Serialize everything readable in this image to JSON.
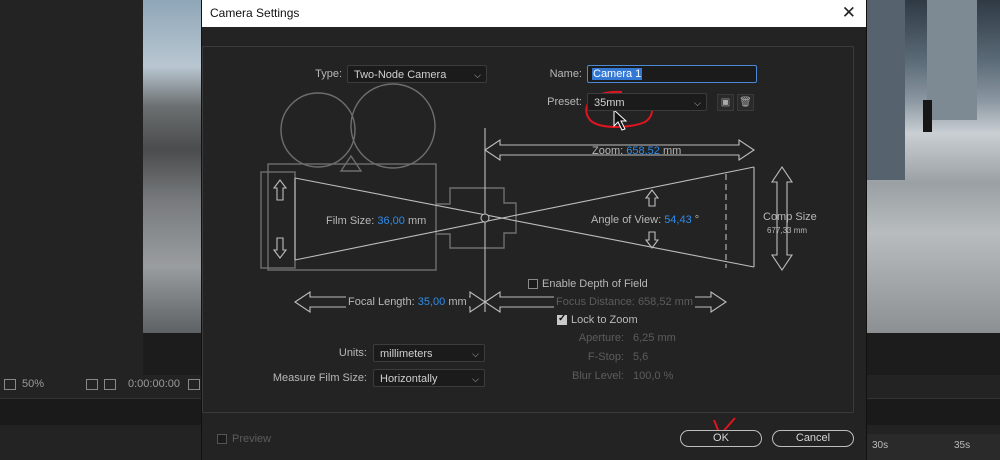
{
  "dialog": {
    "title": "Camera Settings",
    "close_glyph": "✕"
  },
  "type": {
    "label": "Type:",
    "value": "Two-Node Camera"
  },
  "name": {
    "label": "Name:",
    "value": "Camera 1"
  },
  "preset": {
    "label": "Preset:",
    "value": "35mm"
  },
  "zoom": {
    "label": "Zoom:",
    "value": "658,52",
    "unit": "mm"
  },
  "film_size": {
    "label": "Film Size:",
    "value": "36,00",
    "unit": "mm"
  },
  "angle_of_view": {
    "label": "Angle of View:",
    "value": "54,43",
    "unit": "°"
  },
  "comp_size": {
    "label": "Comp Size",
    "value": "677,33 mm"
  },
  "focal_length": {
    "label": "Focal Length:",
    "value": "35,00",
    "unit": "mm"
  },
  "depth_of_field": {
    "enable_label": "Enable Depth of Field",
    "enabled": false,
    "focus_distance_label": "Focus Distance:",
    "focus_distance_value": "658,52",
    "focus_distance_unit": "mm",
    "lock_to_zoom_label": "Lock to Zoom",
    "lock_to_zoom": true,
    "aperture_label": "Aperture:",
    "aperture_value": "6,25",
    "aperture_unit": "mm",
    "fstop_label": "F-Stop:",
    "fstop_value": "5,6",
    "blur_label": "Blur Level:",
    "blur_value": "100,0",
    "blur_unit": "%"
  },
  "units": {
    "label": "Units:",
    "value": "millimeters"
  },
  "measure_film_size": {
    "label": "Measure Film Size:",
    "value": "Horizontally"
  },
  "preview": {
    "label": "Preview",
    "checked": false
  },
  "buttons": {
    "ok": "OK",
    "cancel": "Cancel"
  },
  "background": {
    "zoom_level": "50%",
    "timecode": "0:00:00:00",
    "ruler_30": "30s",
    "ruler_35": "35s"
  },
  "colors": {
    "accent": "#2d8ceb",
    "annotation": "#e0141e"
  }
}
